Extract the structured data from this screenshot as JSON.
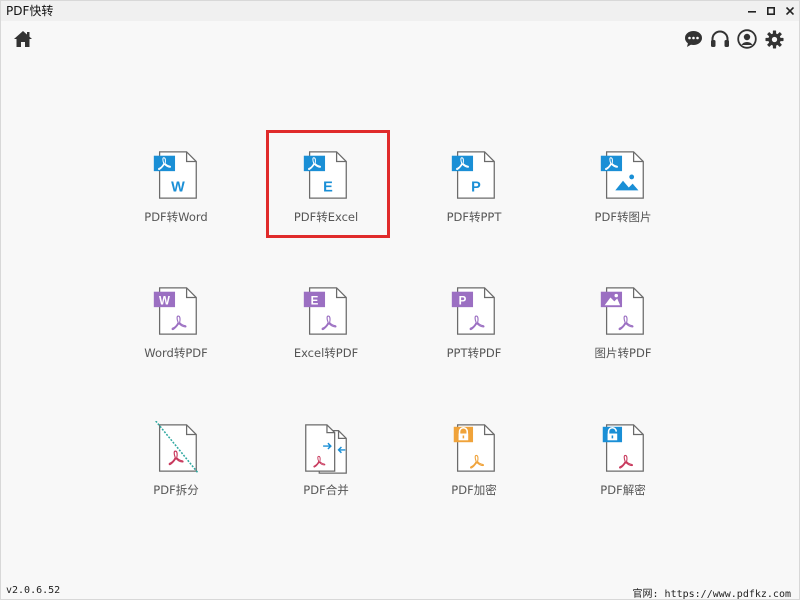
{
  "window": {
    "title": "PDF快转"
  },
  "toolbar": {
    "home_icon": "home-icon",
    "right_icons": [
      "chat-icon",
      "headset-icon",
      "user-icon",
      "gear-icon"
    ]
  },
  "tools": [
    {
      "label": "PDF转Word",
      "badge": "W",
      "badge_type": "pdf-to",
      "letter_color": "#1a8fd6"
    },
    {
      "label": "PDF转Excel",
      "badge": "E",
      "badge_type": "pdf-to",
      "letter_color": "#1a8fd6"
    },
    {
      "label": "PDF转PPT",
      "badge": "P",
      "badge_type": "pdf-to",
      "letter_color": "#1a8fd6"
    },
    {
      "label": "PDF转图片",
      "badge": "image",
      "badge_type": "pdf-to",
      "letter_color": "#1a8fd6"
    },
    {
      "label": "Word转PDF",
      "badge": "W",
      "badge_type": "to-pdf",
      "letter_color": "#9b6fc2"
    },
    {
      "label": "Excel转PDF",
      "badge": "E",
      "badge_type": "to-pdf",
      "letter_color": "#9b6fc2"
    },
    {
      "label": "PPT转PDF",
      "badge": "P",
      "badge_type": "to-pdf",
      "letter_color": "#9b6fc2"
    },
    {
      "label": "图片转PDF",
      "badge": "image",
      "badge_type": "to-pdf",
      "letter_color": "#9b6fc2"
    },
    {
      "label": "PDF拆分",
      "badge": "split",
      "badge_type": "split",
      "letter_color": "#2fa8a0"
    },
    {
      "label": "PDF合并",
      "badge": "merge",
      "badge_type": "merge",
      "letter_color": "#1a8fd6"
    },
    {
      "label": "PDF加密",
      "badge": "lock",
      "badge_type": "lock",
      "letter_color": "#f0a33a"
    },
    {
      "label": "PDF解密",
      "badge": "unlock",
      "badge_type": "unlock",
      "letter_color": "#1a8fd6"
    }
  ],
  "footer": {
    "version": "v2.0.6.52",
    "site": "官网: https://www.pdfkz.com"
  },
  "colors": {
    "accent_blue": "#1a8fd6",
    "accent_purple": "#9b6fc2",
    "highlight_red": "#e02b2b",
    "pdf_red": "#c8385c"
  }
}
